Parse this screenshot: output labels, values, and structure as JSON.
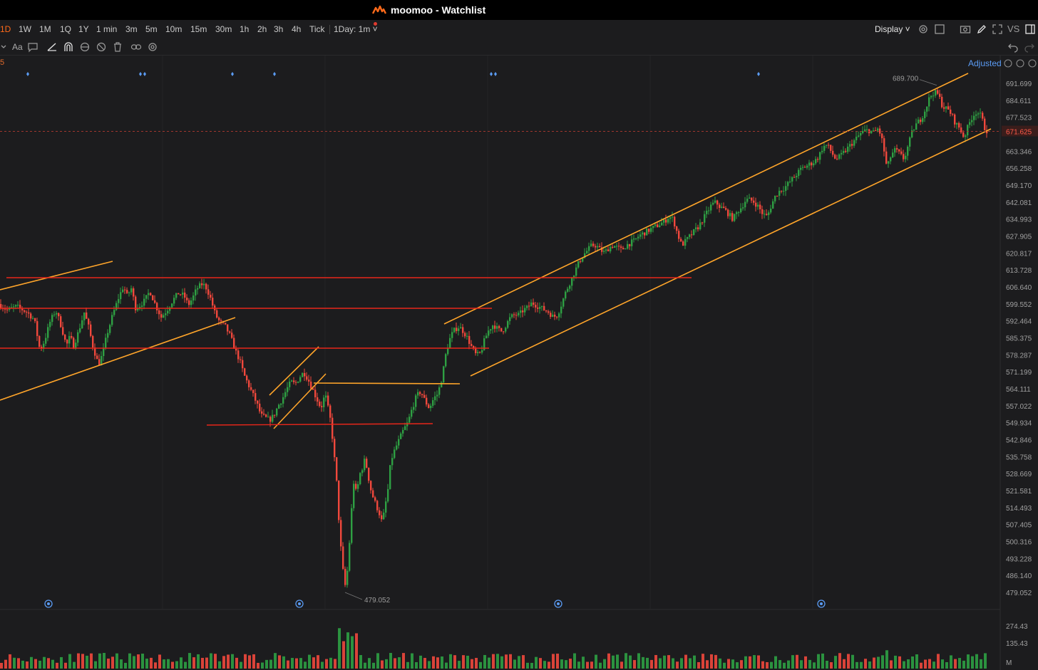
{
  "window": {
    "title": "moomoo - Watchlist"
  },
  "toolbar": {
    "timeframes": [
      "1D",
      "1W",
      "1M",
      "1Q",
      "1Y",
      "1 min",
      "3m",
      "5m",
      "10m",
      "15m",
      "30m",
      "1h",
      "2h",
      "3h",
      "4h",
      "Tick"
    ],
    "active_timeframe": "1D",
    "interval_select": "1Day: 1m",
    "display_label": "Display",
    "vs_label": "VS"
  },
  "drawing_toolbar": {
    "text_tool_label": "Aa"
  },
  "chart": {
    "adjusted_label": "Adjusted",
    "indicator_label": "5",
    "current_price": "671.625",
    "high_label": "689.700",
    "low_label": "479.052",
    "price_axis": [
      "691.699",
      "684.611",
      "677.523",
      "671.625",
      "663.346",
      "656.258",
      "649.170",
      "642.081",
      "634.993",
      "627.905",
      "620.817",
      "613.728",
      "606.640",
      "599.552",
      "592.464",
      "585.375",
      "578.287",
      "571.199",
      "564.111",
      "557.022",
      "549.934",
      "542.846",
      "535.758",
      "528.669",
      "521.581",
      "514.493",
      "507.405",
      "500.316",
      "493.228",
      "486.140",
      "479.052"
    ],
    "volume_axis": [
      "274.43",
      "135.43",
      "M"
    ],
    "colors": {
      "up": "#2ea043",
      "down": "#f0483c",
      "trendline": "#ffa52a",
      "level": "#e8261a",
      "accent": "#ff6a1a",
      "link": "#5b9cf5"
    }
  },
  "chart_data": {
    "type": "candlestick",
    "ylim": [
      479.052,
      691.699
    ],
    "path": [
      [
        0,
        599.5
      ],
      [
        12,
        597
      ],
      [
        25,
        598.5
      ],
      [
        40,
        596
      ],
      [
        50,
        593
      ],
      [
        58,
        580
      ],
      [
        64,
        584
      ],
      [
        72,
        592
      ],
      [
        80,
        597
      ],
      [
        88,
        590
      ],
      [
        95,
        582
      ],
      [
        100,
        586
      ],
      [
        105,
        582
      ],
      [
        112,
        588
      ],
      [
        120,
        596
      ],
      [
        126,
        590
      ],
      [
        132,
        582
      ],
      [
        140,
        574
      ],
      [
        146,
        579
      ],
      [
        152,
        587
      ],
      [
        160,
        595
      ],
      [
        168,
        602
      ],
      [
        175,
        607
      ],
      [
        180,
        603
      ],
      [
        186,
        606
      ],
      [
        192,
        598
      ],
      [
        198,
        599
      ],
      [
        205,
        601
      ],
      [
        212,
        605
      ],
      [
        220,
        599
      ],
      [
        228,
        594
      ],
      [
        236,
        597
      ],
      [
        244,
        601
      ],
      [
        252,
        604
      ],
      [
        260,
        603
      ],
      [
        266,
        599
      ],
      [
        272,
        602
      ],
      [
        278,
        606
      ],
      [
        286,
        608
      ],
      [
        292,
        606
      ],
      [
        298,
        601
      ],
      [
        304,
        595
      ],
      [
        310,
        592
      ],
      [
        318,
        590
      ],
      [
        325,
        586
      ],
      [
        332,
        580
      ],
      [
        338,
        576
      ],
      [
        344,
        570
      ],
      [
        350,
        566
      ],
      [
        356,
        562
      ],
      [
        362,
        558
      ],
      [
        368,
        553
      ],
      [
        374,
        552
      ],
      [
        380,
        551
      ],
      [
        386,
        553
      ],
      [
        392,
        557
      ],
      [
        398,
        560
      ],
      [
        404,
        564
      ],
      [
        410,
        567
      ],
      [
        416,
        566
      ],
      [
        422,
        569
      ],
      [
        428,
        571
      ],
      [
        434,
        568
      ],
      [
        440,
        564
      ],
      [
        446,
        560
      ],
      [
        452,
        556
      ],
      [
        458,
        562
      ],
      [
        462,
        556
      ],
      [
        466,
        550
      ],
      [
        470,
        538
      ],
      [
        474,
        525
      ],
      [
        478,
        505
      ],
      [
        482,
        490
      ],
      [
        486,
        482
      ],
      [
        490,
        490
      ],
      [
        494,
        510
      ],
      [
        498,
        525
      ],
      [
        502,
        520
      ],
      [
        506,
        528
      ],
      [
        510,
        531
      ],
      [
        514,
        535
      ],
      [
        518,
        528
      ],
      [
        522,
        522
      ],
      [
        526,
        518
      ],
      [
        530,
        515
      ],
      [
        534,
        512
      ],
      [
        538,
        508
      ],
      [
        542,
        515
      ],
      [
        546,
        522
      ],
      [
        550,
        534
      ],
      [
        556,
        539
      ],
      [
        562,
        543
      ],
      [
        568,
        547
      ],
      [
        574,
        550
      ],
      [
        580,
        556
      ],
      [
        586,
        561
      ],
      [
        592,
        563
      ],
      [
        598,
        559
      ],
      [
        604,
        556
      ],
      [
        610,
        560
      ],
      [
        616,
        562
      ],
      [
        622,
        569
      ],
      [
        628,
        580
      ],
      [
        634,
        586
      ],
      [
        640,
        589
      ],
      [
        646,
        590
      ],
      [
        652,
        588
      ],
      [
        658,
        585
      ],
      [
        664,
        581
      ],
      [
        670,
        578
      ],
      [
        676,
        579
      ],
      [
        682,
        585
      ],
      [
        688,
        589
      ],
      [
        694,
        591
      ],
      [
        700,
        589
      ],
      [
        706,
        588
      ],
      [
        712,
        591
      ],
      [
        718,
        594
      ],
      [
        724,
        595
      ],
      [
        730,
        595
      ],
      [
        736,
        597
      ],
      [
        742,
        598
      ],
      [
        748,
        600
      ],
      [
        754,
        599
      ],
      [
        760,
        598
      ],
      [
        766,
        597
      ],
      [
        772,
        596
      ],
      [
        778,
        594
      ],
      [
        784,
        595
      ],
      [
        790,
        600
      ],
      [
        796,
        605
      ],
      [
        802,
        609
      ],
      [
        808,
        613
      ],
      [
        814,
        617
      ],
      [
        820,
        620
      ],
      [
        826,
        622
      ],
      [
        832,
        624
      ],
      [
        838,
        624
      ],
      [
        844,
        622
      ],
      [
        850,
        621
      ],
      [
        856,
        623
      ],
      [
        862,
        624
      ],
      [
        868,
        623
      ],
      [
        874,
        622
      ],
      [
        880,
        624
      ],
      [
        886,
        625
      ],
      [
        892,
        626
      ],
      [
        898,
        628
      ],
      [
        904,
        629
      ],
      [
        910,
        630
      ],
      [
        916,
        631
      ],
      [
        922,
        632
      ],
      [
        928,
        633
      ],
      [
        934,
        634
      ],
      [
        940,
        636
      ],
      [
        946,
        635
      ],
      [
        952,
        629
      ],
      [
        958,
        624
      ],
      [
        964,
        626
      ],
      [
        970,
        628
      ],
      [
        976,
        630
      ],
      [
        982,
        632
      ],
      [
        988,
        635
      ],
      [
        994,
        638
      ],
      [
        1000,
        641
      ],
      [
        1006,
        642
      ],
      [
        1012,
        640
      ],
      [
        1018,
        639
      ],
      [
        1024,
        637
      ],
      [
        1030,
        635
      ],
      [
        1036,
        638
      ],
      [
        1042,
        640
      ],
      [
        1048,
        643
      ],
      [
        1054,
        643
      ],
      [
        1060,
        642
      ],
      [
        1066,
        640
      ],
      [
        1072,
        637
      ],
      [
        1078,
        636
      ],
      [
        1084,
        641
      ],
      [
        1090,
        645
      ],
      [
        1096,
        647
      ],
      [
        1102,
        648
      ],
      [
        1108,
        650
      ],
      [
        1114,
        652
      ],
      [
        1120,
        654
      ],
      [
        1126,
        656
      ],
      [
        1132,
        657
      ],
      [
        1138,
        658
      ],
      [
        1144,
        659
      ],
      [
        1150,
        661
      ],
      [
        1156,
        665
      ],
      [
        1162,
        666
      ],
      [
        1168,
        663
      ],
      [
        1174,
        660
      ],
      [
        1180,
        661
      ],
      [
        1186,
        663
      ],
      [
        1192,
        665
      ],
      [
        1198,
        667
      ],
      [
        1204,
        669
      ],
      [
        1210,
        671
      ],
      [
        1216,
        672
      ],
      [
        1222,
        672
      ],
      [
        1228,
        671
      ],
      [
        1234,
        673
      ],
      [
        1240,
        667
      ],
      [
        1246,
        656
      ],
      [
        1252,
        662
      ],
      [
        1258,
        664
      ],
      [
        1264,
        662
      ],
      [
        1270,
        660
      ],
      [
        1276,
        666
      ],
      [
        1282,
        672
      ],
      [
        1288,
        675
      ],
      [
        1294,
        677
      ],
      [
        1300,
        681
      ],
      [
        1306,
        686
      ],
      [
        1312,
        688
      ],
      [
        1318,
        687
      ],
      [
        1324,
        682
      ],
      [
        1330,
        681
      ],
      [
        1336,
        679
      ],
      [
        1342,
        675
      ],
      [
        1348,
        673
      ],
      [
        1354,
        669
      ],
      [
        1360,
        674
      ],
      [
        1366,
        678
      ],
      [
        1372,
        680
      ],
      [
        1378,
        678
      ],
      [
        1384,
        672
      ]
    ],
    "annotations": {
      "high": 689.7,
      "low": 479.052,
      "last": 671.625
    }
  }
}
